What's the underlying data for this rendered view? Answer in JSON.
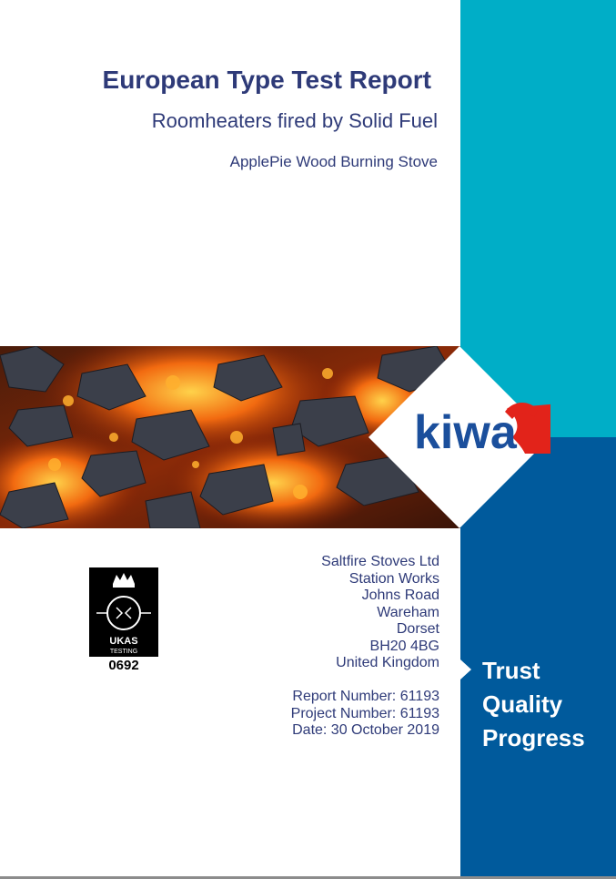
{
  "report": {
    "title": "European Type Test Report",
    "subtitle": "Roomheaters fired by Solid Fuel",
    "product": "ApplePie Wood Burning Stove"
  },
  "brand": {
    "logo_text": "kiwa",
    "tagline": [
      "Trust",
      "Quality",
      "Progress"
    ],
    "colors": {
      "teal": "#00aec7",
      "blue": "#005a9c",
      "navy_text": "#2e3a78",
      "logo_red": "#e2231a",
      "logo_blue": "#1b4f9c"
    }
  },
  "accreditation": {
    "logo_text": "UKAS",
    "logo_subtext": "TESTING",
    "number": "0692"
  },
  "manufacturer": {
    "address_lines": [
      "Saltfire Stoves Ltd",
      "Station Works",
      "Johns Road",
      "Wareham",
      "Dorset",
      "BH20 4BG",
      "United Kingdom"
    ]
  },
  "details": {
    "report_number": "Report Number: 61193",
    "project_number": "Project Number: 61193",
    "date": "Date: 30 October 2019"
  }
}
